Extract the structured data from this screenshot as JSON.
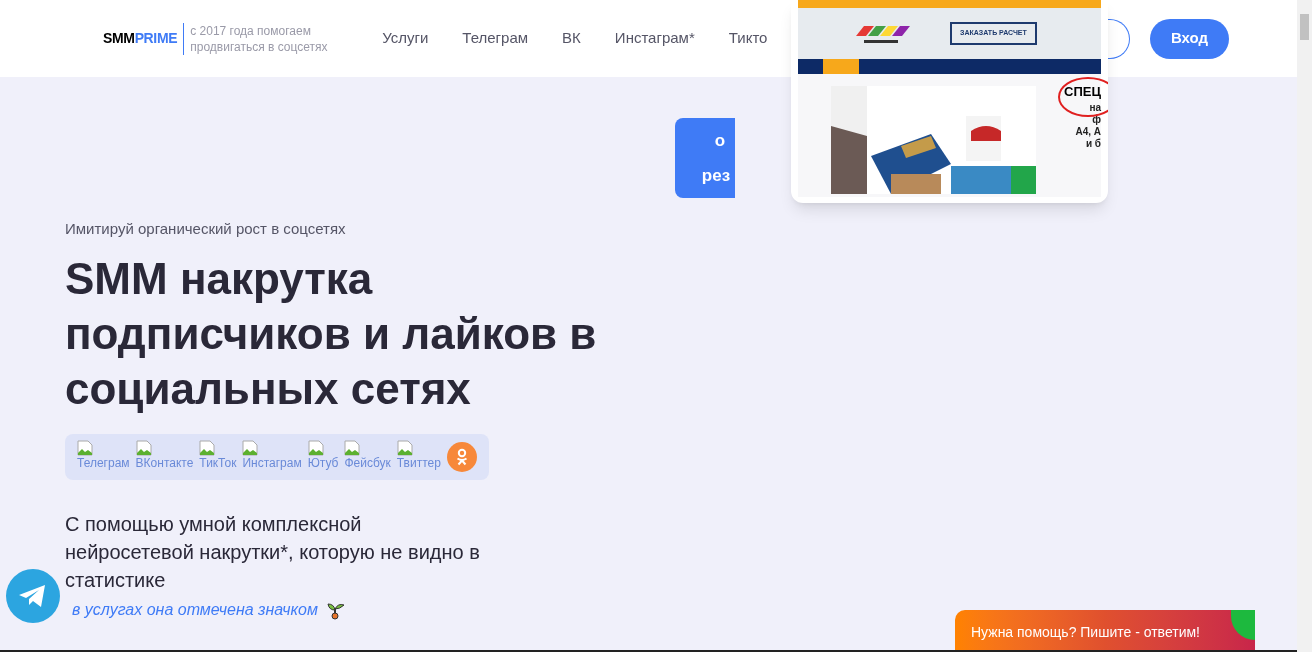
{
  "header": {
    "logo": {
      "part_1": "SMM",
      "part_2": "PRIME"
    },
    "tagline": "с 2017 года помогаем продвигаться в соцсетях",
    "nav": [
      {
        "label": "Услуги"
      },
      {
        "label": "Телеграм"
      },
      {
        "label": "ВК"
      },
      {
        "label": "Инстаграм*"
      },
      {
        "label": "Тикто"
      }
    ],
    "login_button": "Вход"
  },
  "hidden_button": {
    "line_1": "о",
    "line_2": "рез"
  },
  "hero": {
    "eyebrow": "Имитируй органический рост в соцсетях",
    "title": "SMM накрутка подписчиков и лайков в социальных сетях",
    "networks": [
      {
        "alt": "Телеграм"
      },
      {
        "alt": "ВКонтакте"
      },
      {
        "alt": "ТикТок"
      },
      {
        "alt": "Инстаграм"
      },
      {
        "alt": "Ютуб"
      },
      {
        "alt": "Фейсбук"
      },
      {
        "alt": "Твиттер"
      }
    ],
    "description": "С помощью умной комплексной нейросетевой накрутки*, которую не видно в статистике",
    "footnote": "в услугах она отмечена значком"
  },
  "preview": {
    "order_button": "ЗАКАЗАТЬ РАСЧЕТ",
    "promo_lines": [
      "СПЕЦ",
      "на",
      "ф",
      "А4, А",
      "и б"
    ]
  },
  "chat_widget": {
    "text": "Нужна помощь? Пишите - ответим!"
  }
}
